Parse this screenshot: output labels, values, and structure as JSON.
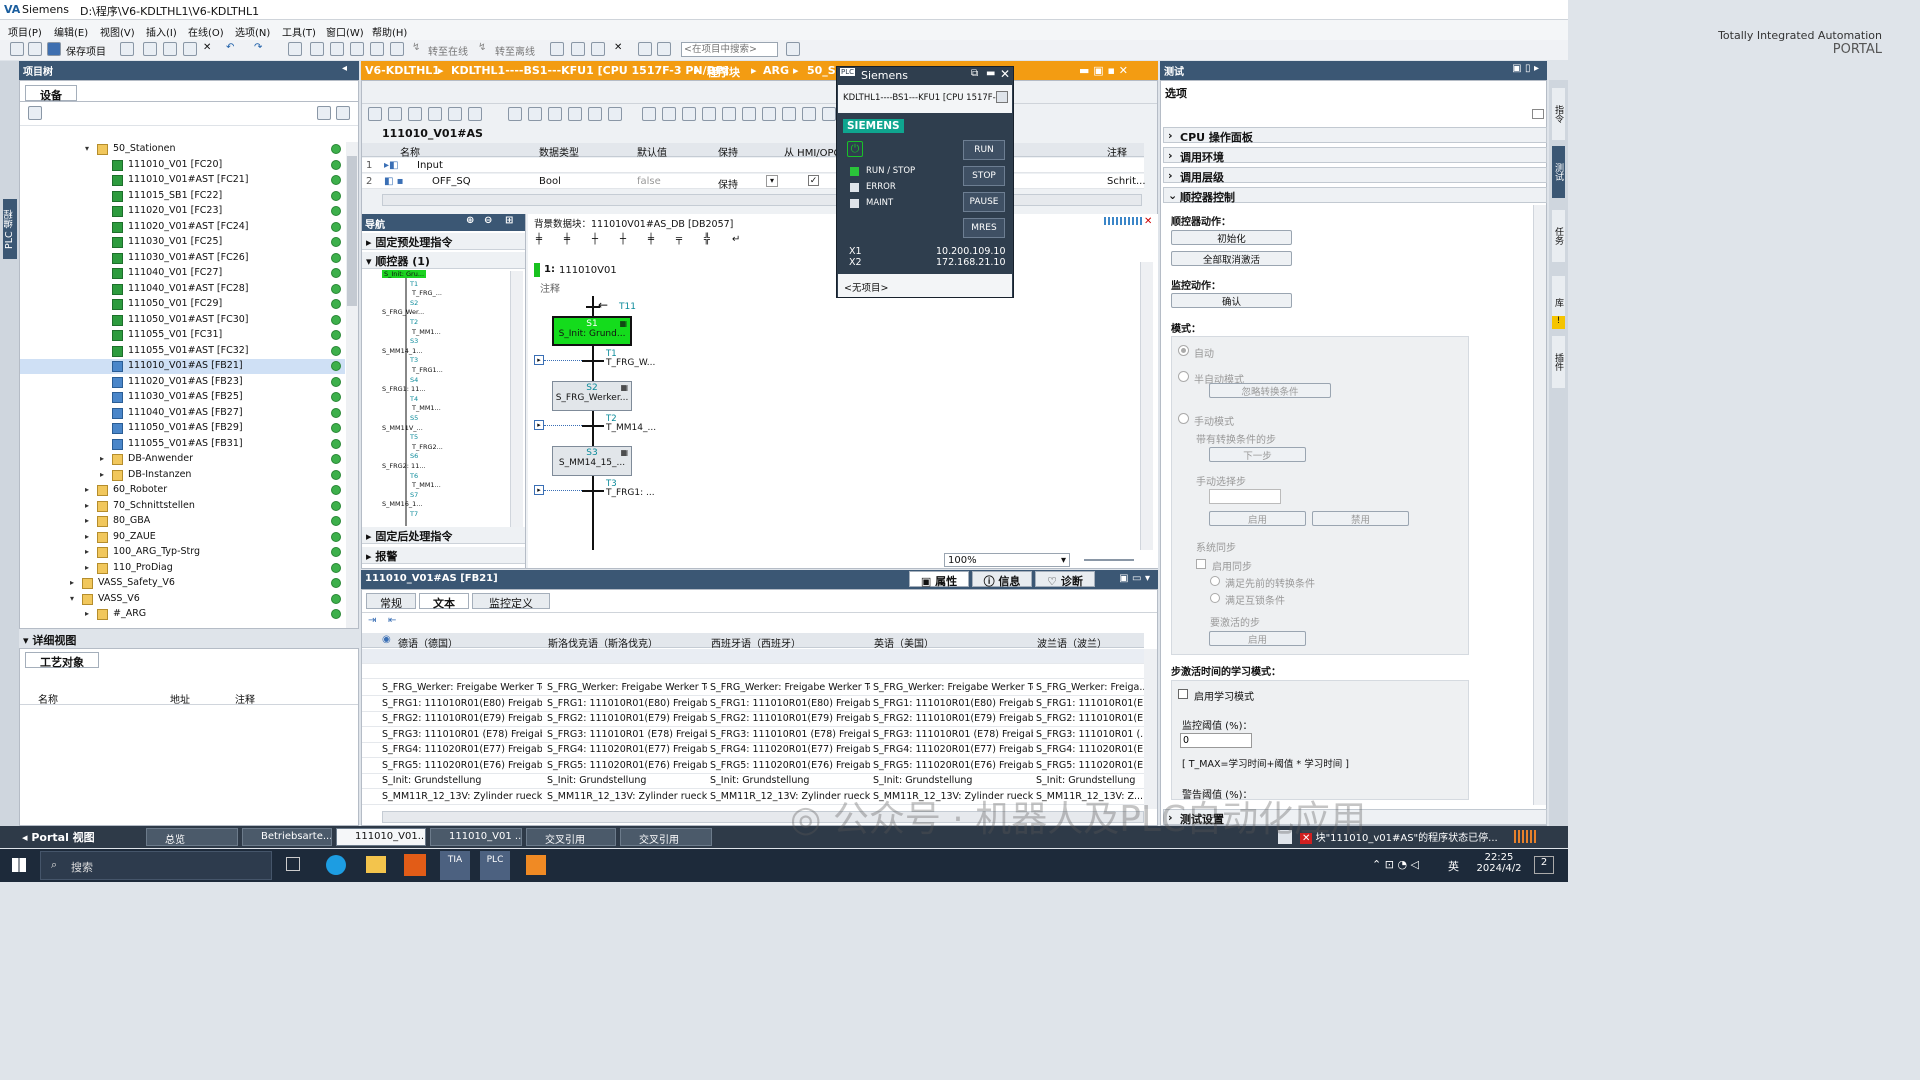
{
  "title": {
    "app": "Siemens",
    "path": "D:\\程序\\V6-KDLTHL1\\V6-KDLTHL1"
  },
  "menu": [
    "项目(P)",
    "编辑(E)",
    "视图(V)",
    "插入(I)",
    "在线(O)",
    "选项(N)",
    "工具(T)",
    "窗口(W)",
    "帮助(H)"
  ],
  "toolbar": {
    "save_project": "保存项目",
    "go_online": "转至在线",
    "go_offline": "转至离线",
    "search_placeholder": "<在项目中搜索>"
  },
  "brand": {
    "line1": "Totally Integrated Automation",
    "line2": "PORTAL"
  },
  "project_tree": {
    "title": "项目树",
    "tab": "设备",
    "items": [
      {
        "label": "50_Stationen",
        "type": "fold",
        "level": 1,
        "arrow": "▾"
      },
      {
        "label": "111010_V01 [FC20]",
        "type": "blk",
        "level": 2
      },
      {
        "label": "111010_V01#AST [FC21]",
        "type": "blk",
        "level": 2
      },
      {
        "label": "111015_SB1 [FC22]",
        "type": "blk",
        "level": 2
      },
      {
        "label": "111020_V01 [FC23]",
        "type": "blk",
        "level": 2
      },
      {
        "label": "111020_V01#AST [FC24]",
        "type": "blk",
        "level": 2
      },
      {
        "label": "111030_V01 [FC25]",
        "type": "blk",
        "level": 2
      },
      {
        "label": "111030_V01#AST [FC26]",
        "type": "blk",
        "level": 2
      },
      {
        "label": "111040_V01 [FC27]",
        "type": "blk",
        "level": 2
      },
      {
        "label": "111040_V01#AST [FC28]",
        "type": "blk",
        "level": 2
      },
      {
        "label": "111050_V01 [FC29]",
        "type": "blk",
        "level": 2
      },
      {
        "label": "111050_V01#AST [FC30]",
        "type": "blk",
        "level": 2
      },
      {
        "label": "111055_V01 [FC31]",
        "type": "blk",
        "level": 2
      },
      {
        "label": "111055_V01#AST [FC32]",
        "type": "blk",
        "level": 2
      },
      {
        "label": "111010_V01#AS [FB21]",
        "type": "db",
        "level": 2,
        "selected": true
      },
      {
        "label": "111020_V01#AS [FB23]",
        "type": "db",
        "level": 2
      },
      {
        "label": "111030_V01#AS [FB25]",
        "type": "db",
        "level": 2
      },
      {
        "label": "111040_V01#AS [FB27]",
        "type": "db",
        "level": 2
      },
      {
        "label": "111050_V01#AS [FB29]",
        "type": "db",
        "level": 2
      },
      {
        "label": "111055_V01#AS [FB31]",
        "type": "db",
        "level": 2
      },
      {
        "label": "DB-Anwender",
        "type": "fold",
        "level": 2,
        "arrow": "▸"
      },
      {
        "label": "DB-Instanzen",
        "type": "fold",
        "level": 2,
        "arrow": "▸"
      },
      {
        "label": "60_Roboter",
        "type": "fold",
        "level": 1,
        "arrow": "▸"
      },
      {
        "label": "70_Schnittstellen",
        "type": "fold",
        "level": 1,
        "arrow": "▸"
      },
      {
        "label": "80_GBA",
        "type": "fold",
        "level": 1,
        "arrow": "▸"
      },
      {
        "label": "90_ZAUE",
        "type": "fold",
        "level": 1,
        "arrow": "▸"
      },
      {
        "label": "100_ARG_Typ-Strg",
        "type": "fold",
        "level": 1,
        "arrow": "▸"
      },
      {
        "label": "110_ProDiag",
        "type": "fold",
        "level": 1,
        "arrow": "▸"
      },
      {
        "label": "VASS_Safety_V6",
        "type": "fold",
        "level": 0,
        "arrow": "▸"
      },
      {
        "label": "VASS_V6",
        "type": "fold",
        "level": 0,
        "arrow": "▾"
      },
      {
        "label": "#_ARG",
        "type": "fold",
        "level": 1,
        "arrow": "▸"
      }
    ]
  },
  "detail_view": {
    "title": "详细视图",
    "tab": "工艺对象",
    "cols": [
      "名称",
      "地址",
      "注释"
    ]
  },
  "editor": {
    "breadcrumb": [
      "V6-KDLTHL1",
      "KDLTHL1----BS1---KFU1 [CPU 1517F-3 PN/DP]",
      "程序块",
      "ARG",
      "50_S"
    ],
    "block_name": "111010_V01#AS",
    "iface_cols": [
      "名称",
      "数据类型",
      "默认值",
      "保持",
      "从 HMI/OPC",
      "注释"
    ],
    "iface_rows": [
      {
        "idx": "1",
        "name": "Input",
        "type": "",
        "default": "",
        "retain": ""
      },
      {
        "idx": "2",
        "name": "OFF_SQ",
        "type": "Bool",
        "default": "false",
        "retain": "保持",
        "comment": "Schrit..."
      }
    ],
    "nav_title": "导航",
    "nav_pre": "固定预处理指令",
    "nav_seq": "顺控器 (1)",
    "nav_post": "固定后处理指令",
    "nav_alarm": "报警",
    "instance_db": "背景数据块：111010V01#AS_DB [DB2057]",
    "seq_label": "1:",
    "seq_name": "111010V01",
    "seq_comment": "注释",
    "steps": [
      {
        "id": "S1",
        "name": "S_Init: Grund...",
        "active": true
      },
      {
        "id": "S2",
        "name": "S_FRG_Werker..."
      },
      {
        "id": "S3",
        "name": "S_MM14_15_..."
      }
    ],
    "transitions": [
      {
        "id": "T11",
        "name": ""
      },
      {
        "id": "T1",
        "name": "T_FRG_W..."
      },
      {
        "id": "T2",
        "name": "T_MM14_..."
      },
      {
        "id": "T3",
        "name": "T_FRG1: ..."
      }
    ],
    "zoom": "100%",
    "mini_steps": [
      "S_Init: Gru...",
      "T1",
      "T_FRG_...",
      "S2",
      "S_FRG_Wer...",
      "T2",
      "T_MM1...",
      "S3",
      "S_MM14_1...",
      "T3",
      "T_FRG1...",
      "S4",
      "S_FRG1: 11...",
      "T4",
      "T_MM1...",
      "S5",
      "S_MM11V_...",
      "T5",
      "T_FRG2...",
      "S6",
      "S_FRG2: 11...",
      "T6",
      "T_MM1...",
      "S7",
      "S_MM16_1...",
      "T7"
    ]
  },
  "props": {
    "title": "111010_V01#AS [FB21]",
    "tabs": [
      "属性",
      "信息",
      "诊断"
    ],
    "subtabs": [
      "常规",
      "文本",
      "监控定义"
    ],
    "cols": [
      "德语（德国）",
      "斯洛伐克语（斯洛伐克）",
      "西班牙语（西班牙）",
      "英语（美国）",
      "波兰语（波兰）"
    ],
    "rows": [
      [
        "S_FRG_Werker: Freigabe Werker Te...",
        "S_FRG_Werker: Freigabe Werker Te...",
        "S_FRG_Werker: Freigabe Werker Te...",
        "S_FRG_Werker: Freigabe Werker Te...",
        "S_FRG_Werker: Freiga..."
      ],
      [
        "S_FRG1: 111010R01(E80) Freigab...",
        "S_FRG1: 111010R01(E80) Freigab...",
        "S_FRG1: 111010R01(E80) Freigab...",
        "S_FRG1: 111010R01(E80) Freigab...",
        "S_FRG1: 111010R01(E..."
      ],
      [
        "S_FRG2: 111010R01(E79) Freigab...",
        "S_FRG2: 111010R01(E79) Freigab...",
        "S_FRG2: 111010R01(E79) Freigab...",
        "S_FRG2: 111010R01(E79) Freigab...",
        "S_FRG2: 111010R01(E..."
      ],
      [
        "S_FRG3: 111010R01 (E78) Freigab...",
        "S_FRG3: 111010R01 (E78) Freigab...",
        "S_FRG3: 111010R01 (E78) Freigab...",
        "S_FRG3: 111010R01 (E78) Freigab...",
        "S_FRG3: 111010R01 (..."
      ],
      [
        "S_FRG4: 111020R01(E77) Freigab...",
        "S_FRG4: 111020R01(E77) Freigab...",
        "S_FRG4: 111020R01(E77) Freigab...",
        "S_FRG4: 111020R01(E77) Freigab...",
        "S_FRG4: 111020R01(E..."
      ],
      [
        "S_FRG5: 111020R01(E76) Freigab...",
        "S_FRG5: 111020R01(E76) Freigab...",
        "S_FRG5: 111020R01(E76) Freigab...",
        "S_FRG5: 111020R01(E76) Freigab...",
        "S_FRG5: 111020R01(E..."
      ],
      [
        "S_Init: Grundstellung",
        "S_Init: Grundstellung",
        "S_Init: Grundstellung",
        "S_Init: Grundstellung",
        "S_Init: Grundstellung"
      ],
      [
        "S_MM11R_12_13V: Zylinder rueck...",
        "S_MM11R_12_13V: Zylinder rueck...",
        "S_MM11R_12_13V: Zylinder rueck...",
        "S_MM11R_12_13V: Zylinder rueck...",
        "S_MM11R_12_13V: Z..."
      ]
    ]
  },
  "plcsim": {
    "title": "Siemens",
    "device": "KDLTHL1----BS1---KFU1 [CPU 1517F-3",
    "brand": "SIEMENS",
    "run_stop": "RUN / STOP",
    "error": "ERROR",
    "maint": "MAINT",
    "buttons": [
      "RUN",
      "STOP",
      "PAUSE",
      "MRES"
    ],
    "x1_label": "X1",
    "x1": "10.200.109.10",
    "x2_label": "X2",
    "x2": "172.168.21.10",
    "footer": "<无项目>"
  },
  "test": {
    "title": "测试",
    "options": "选项",
    "sections": [
      "CPU 操作面板",
      "调用环境",
      "调用层级",
      "顺控器控制"
    ],
    "seq_actions": "顺控器动作：",
    "init": "初始化",
    "cancel_all": "全部取消激活",
    "monitor_actions": "监控动作：",
    "ack": "确认",
    "mode": "模式：",
    "auto": "自动",
    "semi": "半自动模式",
    "ignore_trans": "忽略转换条件",
    "manual": "手动模式",
    "with_trans": "带有转换条件的步",
    "next_step": "下一步",
    "manual_select": "手动选择步",
    "enable": "启用",
    "disable": "禁用",
    "sys_sync": "系统同步",
    "enable_sync": "启用同步",
    "cond1": "满足先前的转换条件",
    "cond2": "满足互锁条件",
    "step_to_activate": "要激活的步",
    "activate": "启用",
    "learn_title": "步激活时间的学习模式：",
    "enable_learn": "启用学习模式",
    "monitor_threshold": "监控阈值 (%)：",
    "threshold_value": "0",
    "formula": "[ T_MAX=学习时间+阈值 * 学习时间 ]",
    "warn_threshold": "警告阈值 (%)：",
    "test_settings": "测试设置"
  },
  "side_tabs": {
    "left": "PLC 编程",
    "right": [
      "指令",
      "测试",
      "任务",
      "库",
      "插件"
    ]
  },
  "portal_bar": {
    "portal_view": "Portal 视图",
    "items": [
      "总览",
      "Betriebsarte...",
      "111010_V01...",
      "111010_V01 ...",
      "交叉引用",
      "交叉引用"
    ],
    "status": "块\"111010_v01#AS\"的程序状态已停..."
  },
  "watermark": "公众号 · 机器人及PLC自动化应用",
  "windows": {
    "search": "搜索",
    "time": "22:25",
    "date": "2024/4/2",
    "ime": "英",
    "notif": "2"
  }
}
